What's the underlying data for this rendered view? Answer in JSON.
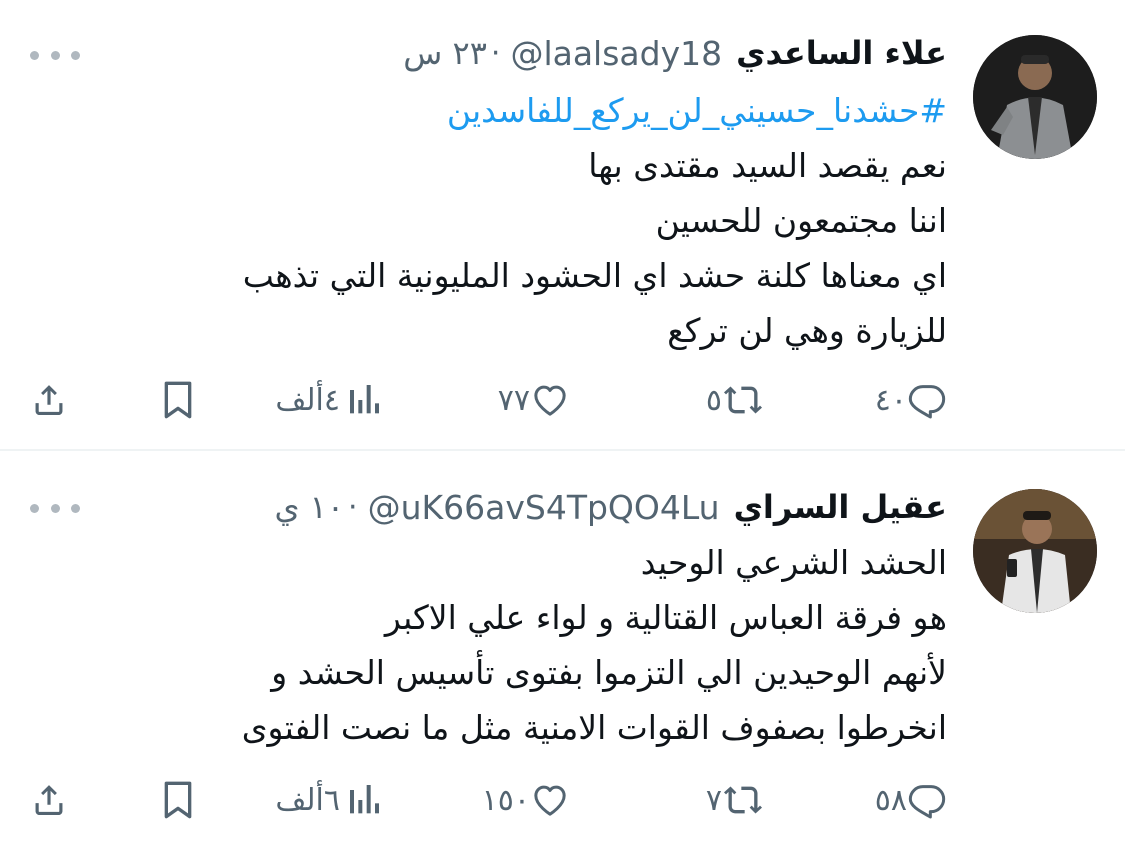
{
  "colors": {
    "text": "#0f1419",
    "secondary": "#536471",
    "link": "#1d9bf0",
    "divider": "#eff3f4"
  },
  "tweets": [
    {
      "display_name": "علاء الساعدي",
      "handle": "@laalsady18",
      "separator": "·",
      "time": "٢٣ س",
      "hashtag": "#حشدنا_حسيني_لن_يركع_للفاسدين",
      "lines": [
        "نعم يقصد السيد مقتدى بها",
        "اننا مجتمعون للحسين",
        "اي معناها كلنة حشد اي الحشود المليونية التي تذهب",
        "للزيارة وهي لن تركع"
      ],
      "actions": {
        "replies": "٤٠",
        "retweets": "٥",
        "likes": "٧٧",
        "views": "٤ألف"
      },
      "icons": [
        "reply-icon",
        "retweet-icon",
        "like-icon",
        "views-icon",
        "bookmark-icon",
        "share-icon"
      ]
    },
    {
      "display_name": "عقيل السراي",
      "handle": "@uK66avS4TpQO4Lu",
      "separator": "·",
      "time": "١٠ ي",
      "lines": [
        "الحشد الشرعي الوحيد",
        "هو فرقة العباس القتالية و لواء علي الاكبر",
        "لأنهم الوحيدين الي التزموا بفتوى تأسيس الحشد و",
        "انخرطوا بصفوف القوات الامنية مثل ما نصت الفتوى"
      ],
      "actions": {
        "replies": "٥٨",
        "retweets": "٧",
        "likes": "١٥٠",
        "views": "٦ألف"
      },
      "icons": [
        "reply-icon",
        "retweet-icon",
        "like-icon",
        "views-icon",
        "bookmark-icon",
        "share-icon"
      ]
    }
  ]
}
